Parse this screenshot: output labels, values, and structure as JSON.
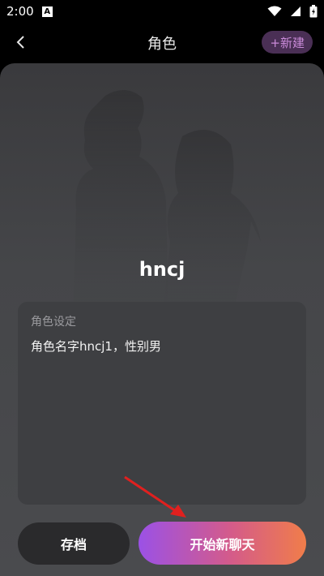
{
  "status_bar": {
    "time": "2:00",
    "notification_icon": "A"
  },
  "header": {
    "back_icon": "chevron-left",
    "title": "角色",
    "new_button": "+新建"
  },
  "character": {
    "name": "hncj",
    "setting_label": "角色设定",
    "setting_value": "角色名字hncj1，性别男"
  },
  "actions": {
    "save_label": "存档",
    "start_label": "开始新聊天"
  },
  "colors": {
    "accent_start": "#9b51e6",
    "accent_end": "#f07d4a",
    "new_button_bg": "#4a2f55",
    "annotation_arrow": "#e0201f"
  }
}
